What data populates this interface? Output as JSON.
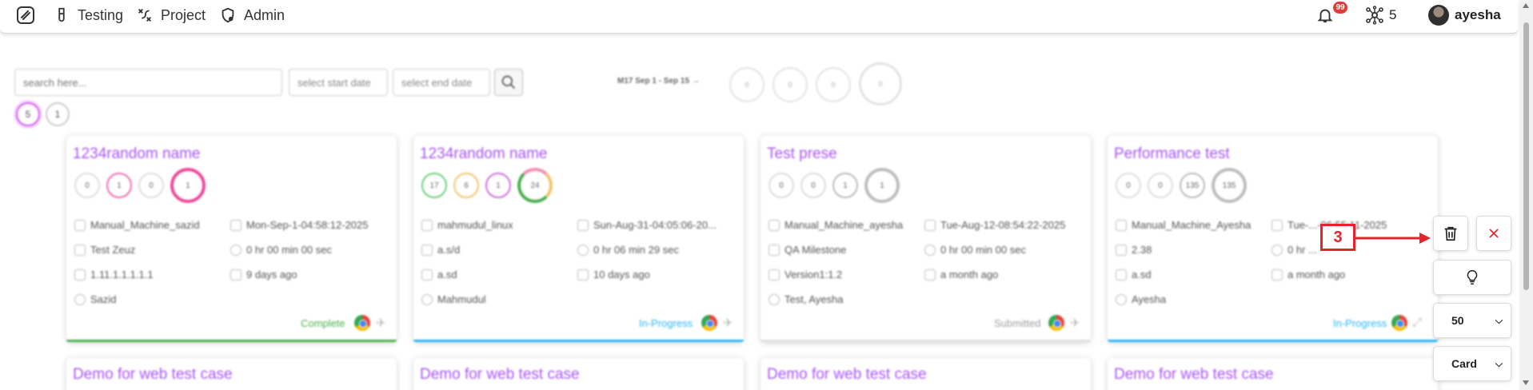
{
  "nav": {
    "logo_icon": "pen-swirl-logo",
    "items": [
      {
        "label": "Testing",
        "icon": "flask-icon"
      },
      {
        "label": "Project",
        "icon": "project-icon"
      },
      {
        "label": "Admin",
        "icon": "admin-shield-icon"
      }
    ],
    "notification_count": "99",
    "network_count": "5",
    "username": "ayesha"
  },
  "filters": {
    "search_placeholder": "search here...",
    "start_date_placeholder": "select start date",
    "end_date_placeholder": "select end date",
    "milestone_label": "M17 Sep 1 - Sep 15 →",
    "milestone_counts": [
      "0",
      "0",
      "0",
      "0"
    ],
    "mini_counts": [
      "5",
      "1"
    ]
  },
  "cards": [
    {
      "title": "1234random name",
      "stats": [
        "0",
        "1",
        "0",
        "1"
      ],
      "machine": "Manual_Machine_sazid",
      "date": "Mon-Sep-1-04:58:12-2025",
      "milestone": "Test Zeuz",
      "duration": "0 hr 00 min 00 sec",
      "version": "1.11.1.1.1.1.1",
      "ago": "9 days ago",
      "user": "Sazid",
      "status": "Complete",
      "status_color": "#4caf50"
    },
    {
      "title": "1234random name",
      "stats": [
        "17",
        "6",
        "1",
        "24"
      ],
      "machine": "mahmudul_linux",
      "date": "Sun-Aug-31-04:05:06-20...",
      "milestone": "a.s/d",
      "duration": "0 hr 06 min 29 sec",
      "version": "a.sd",
      "ago": "10 days ago",
      "user": "Mahmudul",
      "status": "In-Progress",
      "status_color": "#29b6f6"
    },
    {
      "title": "Test prese",
      "stats": [
        "0",
        "0",
        "1",
        "1"
      ],
      "machine": "Manual_Machine_ayesha",
      "date": "Tue-Aug-12-08:54:22-2025",
      "milestone": "QA Milestone",
      "duration": "0 hr 00 min 00 sec",
      "version": "Version1:1.2",
      "ago": "a month ago",
      "user": "Test, Ayesha",
      "status": "Submitted",
      "status_color": "#9e9e9e"
    },
    {
      "title": "Performance test",
      "stats": [
        "0",
        "0",
        "135",
        "135"
      ],
      "machine": "Manual_Machine_Ayesha",
      "date": "Tue-...-06:55:11-2025",
      "milestone": "2.38",
      "duration": "0 hr ...",
      "version": "a.sd",
      "ago": "a month ago",
      "user": "Ayesha",
      "status": "In-Progress",
      "status_color": "#29b6f6"
    }
  ],
  "second_row_titles": [
    "Demo for web test case",
    "Demo for web test case",
    "Demo for web test case",
    "Demo for web test case"
  ],
  "sidebar": {
    "page_size": "50",
    "view_mode": "Card",
    "delete_icon": "trash-icon",
    "close_icon": "close-icon",
    "hint_icon": "lightbulb-icon"
  },
  "annotation": {
    "label": "3",
    "color": "#e3242b"
  }
}
